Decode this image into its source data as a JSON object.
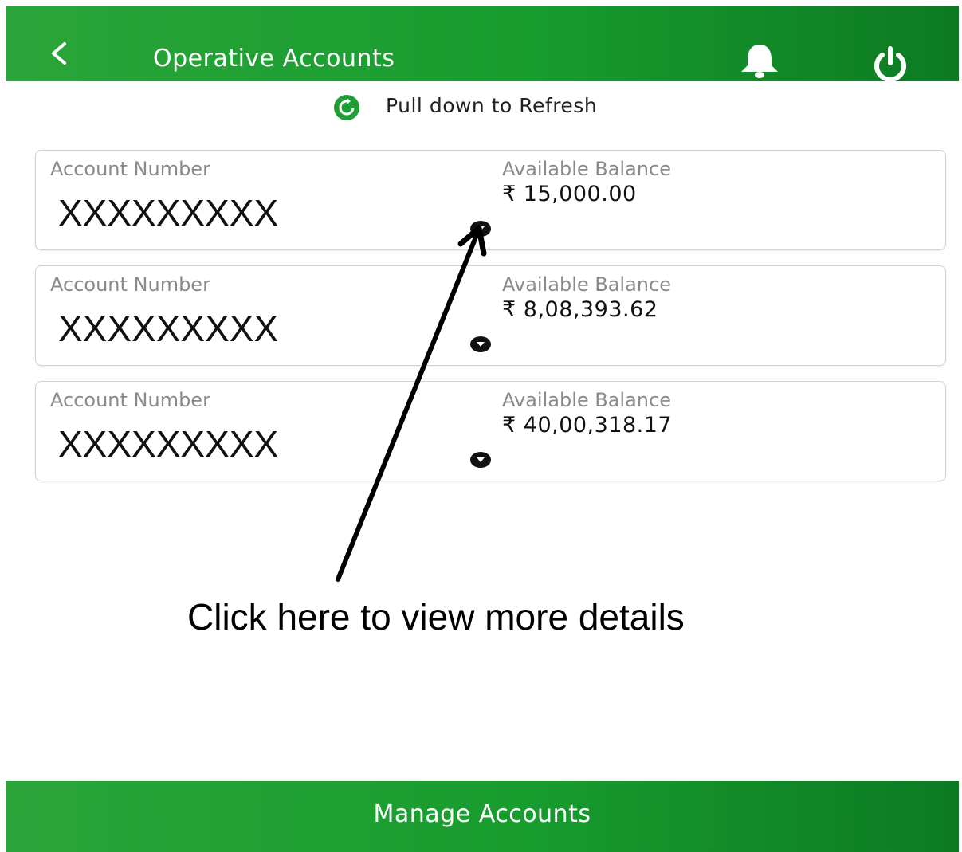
{
  "header": {
    "title": "Operative Accounts",
    "back_icon": "chevron-left-icon",
    "notification_icon": "bell-icon",
    "logout_icon": "power-icon"
  },
  "refresh": {
    "icon": "refresh-icon",
    "text": "Pull down to Refresh"
  },
  "accounts": [
    {
      "account_label": "Account Number",
      "account_number": "XXXXXXXXX",
      "balance_label": "Available Balance",
      "balance": "₹ 15,000.00"
    },
    {
      "account_label": "Account Number",
      "account_number": "XXXXXXXXX",
      "balance_label": "Available Balance",
      "balance": "₹ 8,08,393.62"
    },
    {
      "account_label": "Account Number",
      "account_number": "XXXXXXXXX",
      "balance_label": "Available Balance",
      "balance": "₹ 40,00,318.17"
    }
  ],
  "annotation": {
    "text": "Click here to view more details"
  },
  "footer": {
    "label": "Manage Accounts"
  },
  "colors": {
    "brand_green": "#179c2e",
    "brand_green_dark": "#0d7a22",
    "label_gray": "#8a8a8a"
  }
}
